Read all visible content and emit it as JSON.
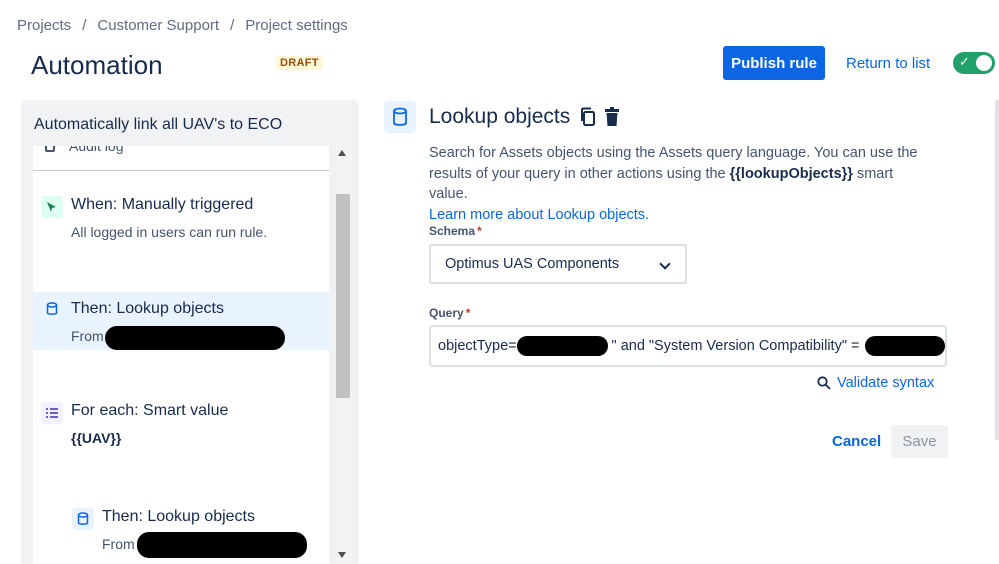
{
  "breadcrumb": [
    "Projects",
    "Customer Support",
    "Project settings"
  ],
  "page_title": "Automation",
  "draft_badge": "DRAFT",
  "publish_label": "Publish rule",
  "return_label": "Return to list",
  "toggle_state": "on",
  "rule": {
    "name": "Automatically link all UAV's to ECO",
    "audit_label": "Audit log",
    "steps": [
      {
        "title": "When: Manually triggered",
        "sub": "All logged in users can run rule."
      },
      {
        "title": "Then: Lookup objects",
        "sub": "From"
      },
      {
        "title": "For each: Smart value",
        "sub": "{{UAV}}"
      },
      {
        "title": "Then: Lookup objects",
        "sub": "From"
      }
    ]
  },
  "action": {
    "title": "Lookup objects",
    "desc_1": "Search for Assets objects using the Assets query language. You can use the",
    "desc_2a": "results of your query in other actions using the",
    "desc_2b": "{{lookupObjects}}",
    "desc_2c": "smart value.",
    "learn_more": "Learn more about Lookup objects.",
    "schema_label": "Schema",
    "schema_value": "Optimus UAS Components",
    "query_label": "Query",
    "query_part1": "objectType=",
    "query_part2": "\" and \"System Version Compatibility\" =",
    "validate_label": "Validate syntax",
    "cancel_label": "Cancel",
    "save_label": "Save",
    "required_mark": "*"
  },
  "colors": {
    "primary": "#0c66e4",
    "toggle_on": "#22a06b",
    "selected_bg": "#e9f2ff"
  }
}
